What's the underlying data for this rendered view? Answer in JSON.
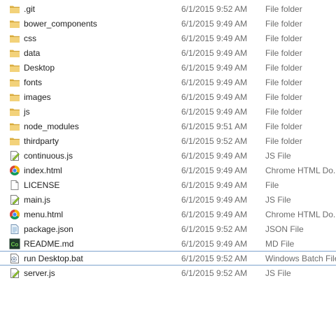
{
  "files": [
    {
      "name": ".git",
      "modified": "6/1/2015 9:52 AM",
      "type": "File folder",
      "icon": "folder-icon"
    },
    {
      "name": "bower_components",
      "modified": "6/1/2015 9:49 AM",
      "type": "File folder",
      "icon": "folder-icon"
    },
    {
      "name": "css",
      "modified": "6/1/2015 9:49 AM",
      "type": "File folder",
      "icon": "folder-icon"
    },
    {
      "name": "data",
      "modified": "6/1/2015 9:49 AM",
      "type": "File folder",
      "icon": "folder-icon"
    },
    {
      "name": "Desktop",
      "modified": "6/1/2015 9:49 AM",
      "type": "File folder",
      "icon": "folder-icon"
    },
    {
      "name": "fonts",
      "modified": "6/1/2015 9:49 AM",
      "type": "File folder",
      "icon": "folder-icon"
    },
    {
      "name": "images",
      "modified": "6/1/2015 9:49 AM",
      "type": "File folder",
      "icon": "folder-icon"
    },
    {
      "name": "js",
      "modified": "6/1/2015 9:49 AM",
      "type": "File folder",
      "icon": "folder-icon"
    },
    {
      "name": "node_modules",
      "modified": "6/1/2015 9:51 AM",
      "type": "File folder",
      "icon": "folder-icon"
    },
    {
      "name": "thirdparty",
      "modified": "6/1/2015 9:52 AM",
      "type": "File folder",
      "icon": "folder-icon"
    },
    {
      "name": "continuous.js",
      "modified": "6/1/2015 9:49 AM",
      "type": "JS File",
      "icon": "js-file-icon"
    },
    {
      "name": "index.html",
      "modified": "6/1/2015 9:49 AM",
      "type": "Chrome HTML Do...",
      "icon": "chrome-icon"
    },
    {
      "name": "LICENSE",
      "modified": "6/1/2015 9:49 AM",
      "type": "File",
      "icon": "blank-file-icon"
    },
    {
      "name": "main.js",
      "modified": "6/1/2015 9:49 AM",
      "type": "JS File",
      "icon": "js-file-icon"
    },
    {
      "name": "menu.html",
      "modified": "6/1/2015 9:49 AM",
      "type": "Chrome HTML Do...",
      "icon": "chrome-icon"
    },
    {
      "name": "package.json",
      "modified": "6/1/2015 9:52 AM",
      "type": "JSON File",
      "icon": "json-file-icon"
    },
    {
      "name": "README.md",
      "modified": "6/1/2015 9:49 AM",
      "type": "MD File",
      "icon": "markdown-app-icon",
      "icon_label": "Co"
    },
    {
      "name": "run Desktop.bat",
      "modified": "6/1/2015 9:52 AM",
      "type": "Windows Batch File",
      "icon": "batch-file-icon",
      "selected": true
    },
    {
      "name": "server.js",
      "modified": "6/1/2015 9:52 AM",
      "type": "JS File",
      "icon": "js-file-icon"
    }
  ],
  "colors": {
    "folder": "#e8c35a",
    "selection_border": "#7da2ce",
    "secondary_text": "#6d6d6d"
  }
}
